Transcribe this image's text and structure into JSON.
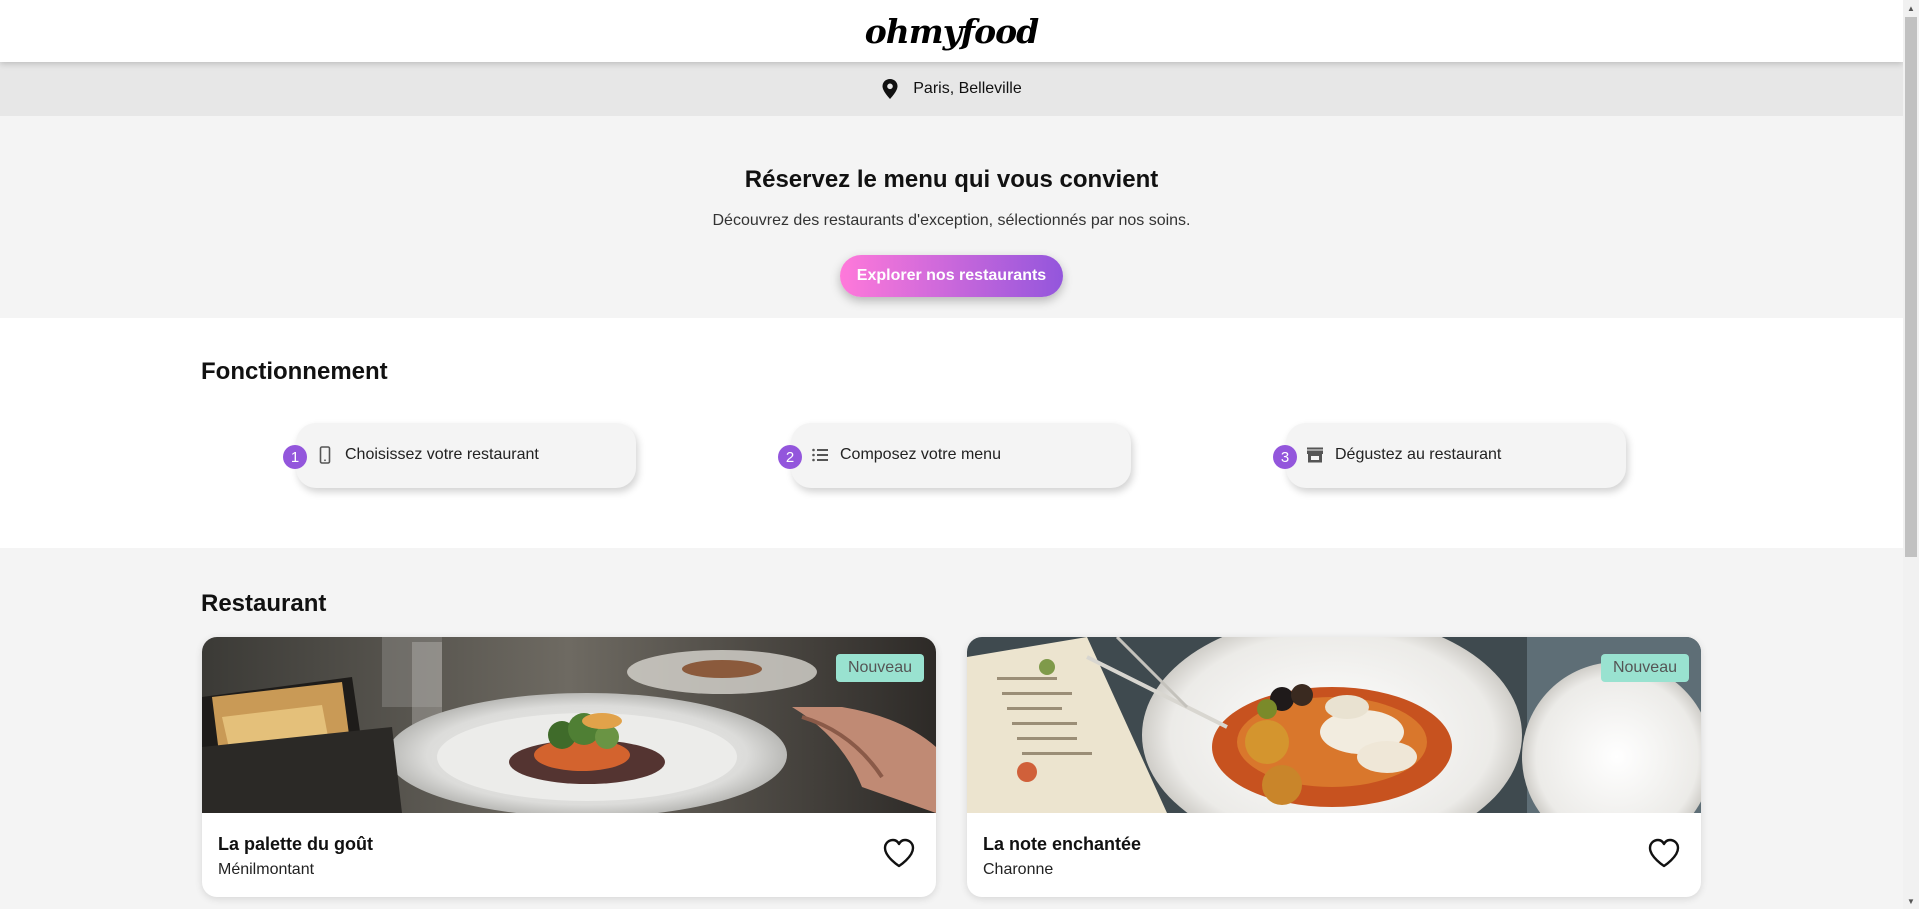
{
  "header": {
    "logo": "ohmyfood"
  },
  "location": {
    "icon": "map-pin-icon",
    "text": "Paris, Belleville"
  },
  "hero": {
    "title": "Réservez le menu qui vous convient",
    "subtitle": "Découvrez des restaurants d'exception, sélectionnés par nos soins.",
    "cta_label": "Explorer nos restaurants"
  },
  "how": {
    "title": "Fonctionnement",
    "steps": [
      {
        "number": "1",
        "icon": "mobile-phone-icon",
        "label": "Choisissez votre restaurant"
      },
      {
        "number": "2",
        "icon": "list-icon",
        "label": "Composez votre menu"
      },
      {
        "number": "3",
        "icon": "store-icon",
        "label": "Dégustez au restaurant"
      }
    ]
  },
  "restaurants": {
    "title": "Restaurant",
    "items": [
      {
        "name": "La palette du goût",
        "area": "Ménilmontant",
        "badge": "Nouveau",
        "icon": "heart-icon"
      },
      {
        "name": "La note enchantée",
        "area": "Charonne",
        "badge": "Nouveau",
        "icon": "heart-icon"
      }
    ]
  },
  "colors": {
    "accent_start": "#ff79da",
    "accent_end": "#9356dc",
    "badge": "#99e2d0",
    "step_number": "#9356dc"
  }
}
